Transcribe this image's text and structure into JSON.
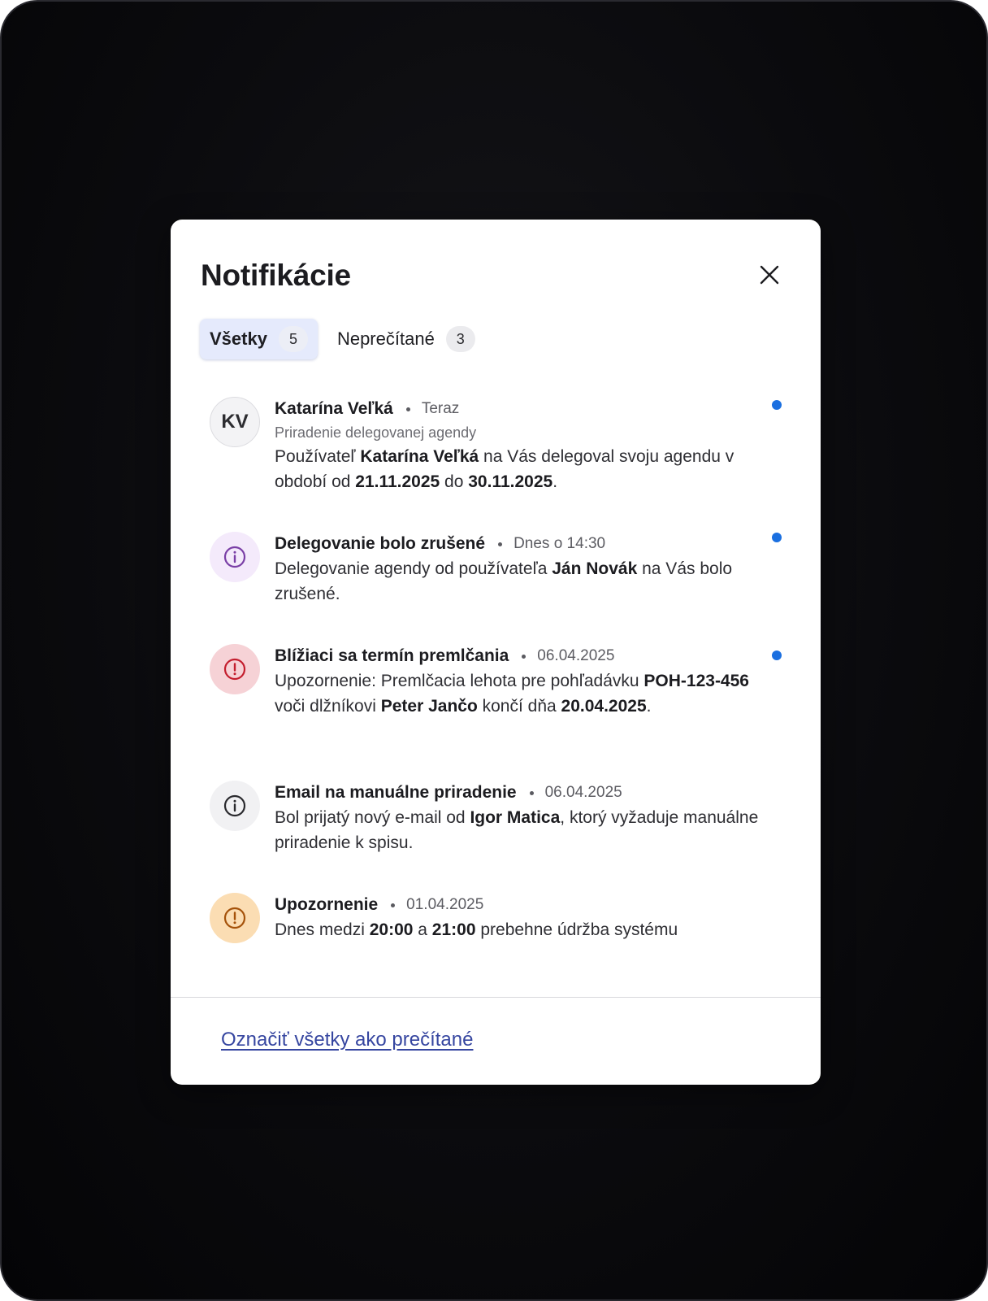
{
  "modal": {
    "title": "Notifikácie",
    "close_label": "Zavrieť"
  },
  "tabs": [
    {
      "label": "Všetky",
      "count": "5",
      "active": true
    },
    {
      "label": "Neprečítané",
      "count": "3",
      "active": false
    }
  ],
  "notifications": [
    {
      "avatar_type": "initials",
      "initials": "KV",
      "title": "Katarína Veľká",
      "time": "Teraz",
      "subtitle": "Priradenie delegovanej agendy",
      "text_parts": [
        {
          "t": "Používateľ "
        },
        {
          "t": "Katarína Veľká",
          "b": true
        },
        {
          "t": " na Vás delegoval svoju agendu v období od "
        },
        {
          "t": "21.11.2025",
          "b": true
        },
        {
          "t": " do "
        },
        {
          "t": "30.11.2025",
          "b": true
        },
        {
          "t": "."
        }
      ],
      "unread": true
    },
    {
      "avatar_type": "info-icon",
      "tone": "purple",
      "icon_color": "#7a3fa6",
      "title": "Delegovanie bolo zrušené",
      "time": "Dnes o 14:30",
      "text_parts": [
        {
          "t": "Delegovanie agendy od používateľa "
        },
        {
          "t": "Ján Novák",
          "b": true
        },
        {
          "t": " na Vás bolo zrušené."
        }
      ],
      "unread": true
    },
    {
      "avatar_type": "alert-icon",
      "tone": "red",
      "icon_color": "#c41e2e",
      "title": "Blížiaci sa termín premlčania",
      "time": "06.04.2025",
      "text_parts": [
        {
          "t": "Upozornenie: Premlčacia lehota pre pohľadávku "
        },
        {
          "t": "POH-123-456",
          "b": true
        },
        {
          "t": " voči dlžníkovi "
        },
        {
          "t": "Peter Jančo",
          "b": true
        },
        {
          "t": " končí dňa "
        },
        {
          "t": "20.04.2025",
          "b": true
        },
        {
          "t": "."
        }
      ],
      "unread": true
    },
    {
      "avatar_type": "info-icon",
      "tone": "gray",
      "icon_color": "#2a2a2e",
      "title": "Email na manuálne priradenie",
      "time": "06.04.2025",
      "text_parts": [
        {
          "t": "Bol prijatý nový e-mail od "
        },
        {
          "t": "Igor Matica",
          "b": true
        },
        {
          "t": ", ktorý vyžaduje manuálne priradenie k spisu."
        }
      ],
      "unread": false
    },
    {
      "avatar_type": "alert-icon",
      "tone": "orange",
      "icon_color": "#a5520a",
      "title": "Upozornenie",
      "time": "01.04.2025",
      "text_parts": [
        {
          "t": "Dnes medzi "
        },
        {
          "t": "20:00",
          "b": true
        },
        {
          "t": " a "
        },
        {
          "t": "21:00",
          "b": true
        },
        {
          "t": " prebehne údržba systému"
        }
      ],
      "unread": false
    }
  ],
  "footer": {
    "mark_all_label": "Označiť všetky ako prečítané"
  },
  "colors": {
    "accent_link": "#3646a0",
    "unread_dot": "#1a6fe0",
    "active_tab_bg": "#e5eafc"
  }
}
